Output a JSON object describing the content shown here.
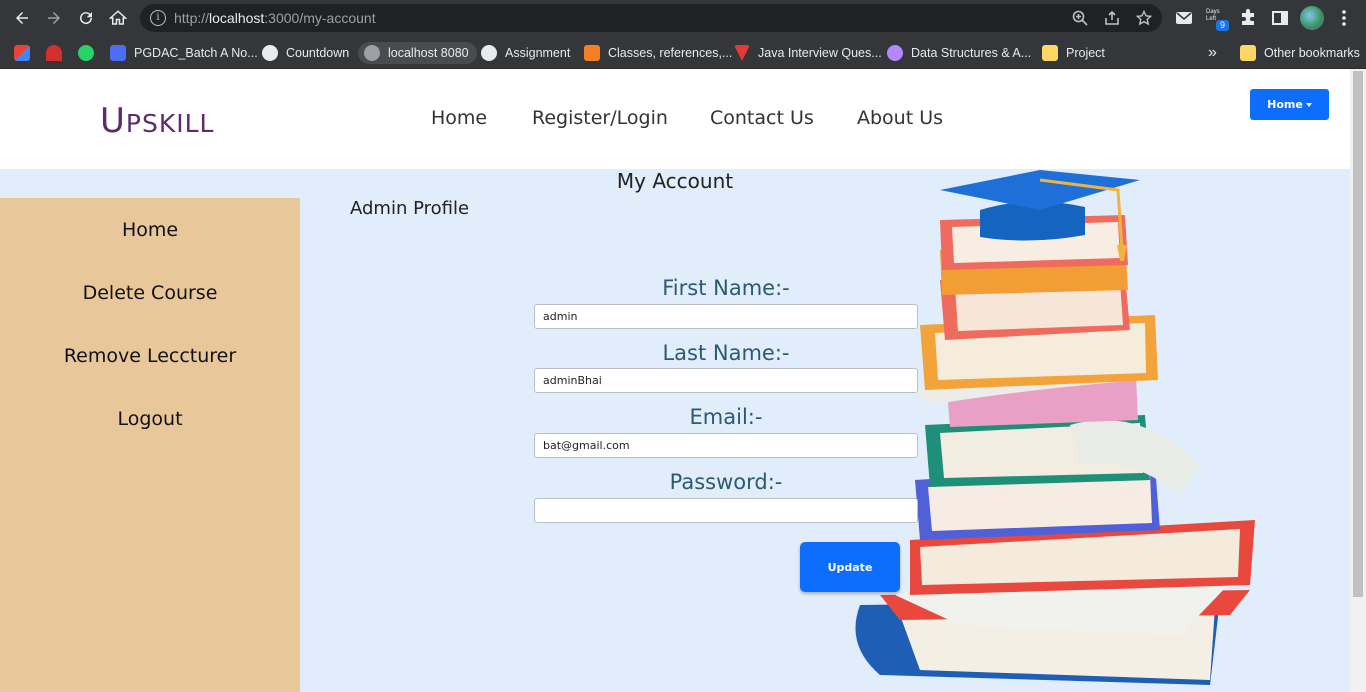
{
  "browser": {
    "url_prefix": "http://",
    "url_host": "localhost",
    "url_rest": ":3000/my-account",
    "days_badge_label": "Days Left",
    "days_badge_count": "9",
    "bookmarks": [
      {
        "label": "",
        "color": "#ea4335"
      },
      {
        "label": "",
        "color": "#d32f2f"
      },
      {
        "label": "",
        "color": "#25d366"
      },
      {
        "label": "PGDAC_Batch A No...",
        "color": "#4c6ef5"
      },
      {
        "label": "Countdown",
        "color": "#e8eaed"
      },
      {
        "label": "localhost 8080",
        "color": "#9aa0a6"
      },
      {
        "label": "Assignment",
        "color": "#e8eaed"
      },
      {
        "label": "Classes, references,...",
        "color": "#f48024"
      },
      {
        "label": "Java Interview Ques...",
        "color": "#e53935"
      },
      {
        "label": "Data Structures & A...",
        "color": "#b388ff"
      },
      {
        "label": "Project",
        "color": "#fdd663"
      }
    ],
    "overflow_label": "»",
    "other_bookmarks": "Other bookmarks"
  },
  "site": {
    "logo_first": "U",
    "logo_rest": "PSKILL",
    "nav": [
      "Home",
      "Register/Login",
      "Contact Us",
      "About Us"
    ],
    "dropdown_label": "Home"
  },
  "sidebar": {
    "items": [
      "Home",
      "Delete Course",
      "Remove Leccturer",
      "Logout"
    ]
  },
  "main": {
    "heading": "My Account",
    "subheading": "Admin Profile",
    "fields": [
      {
        "label": "First Name:-",
        "value": "admin"
      },
      {
        "label": "Last Name:-",
        "value": "adminBhai"
      },
      {
        "label": "Email:-",
        "value": "bat@gmail.com"
      },
      {
        "label": "Password:-",
        "value": ""
      }
    ],
    "update_label": "Update"
  },
  "colors": {
    "brand": "#5e2a6e",
    "primary_button": "#0d6efd",
    "sidebar_bg": "#e8c79a",
    "page_bg": "#e1edfb",
    "label_color": "#2b5b6e"
  }
}
